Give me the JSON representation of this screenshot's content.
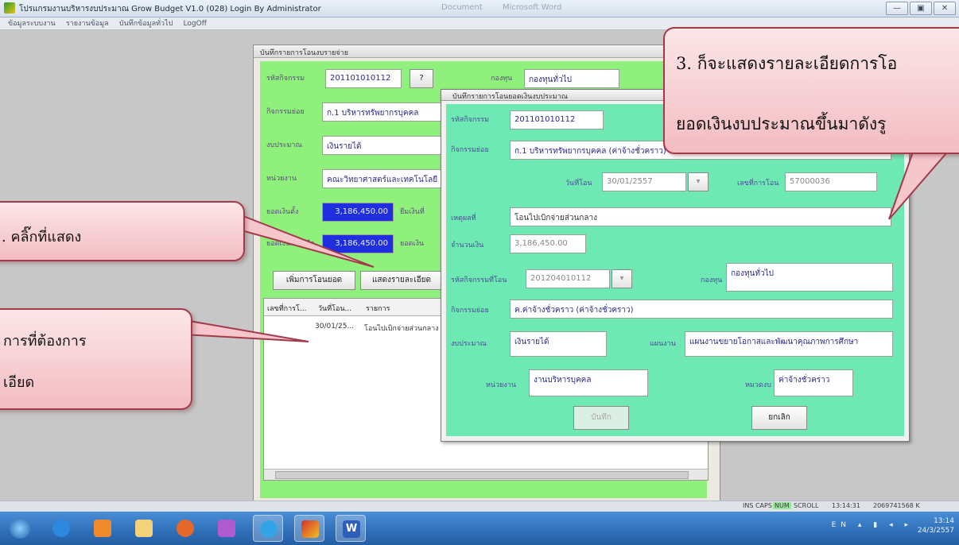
{
  "window": {
    "title": "โปรแกรมงานบริหารงบประมาณ Grow Budget V1.0 (028) Login By Administrator",
    "doc_tabs": [
      "Document",
      "Microsoft Word"
    ],
    "buttons": [
      "—",
      "▣",
      "✕"
    ]
  },
  "menu": [
    "ข้อมูลระบบงาน",
    "รายงานข้อมูล",
    "บันทึกข้อมูลทั่วไป",
    "LogOff"
  ],
  "parent": {
    "title": "บันทึกรายการโอนงบรายจ่าย",
    "code_label": "รหัสกิจกรรม",
    "code_value": "201101010112",
    "help_button": "?",
    "fund_group_label": "กองทุน",
    "fund_group_value": "กองทุนทั่วไป",
    "activity_label": "กิจกรรมย่อย",
    "activity_value": "ก.1 บริหารทรัพยากรบุคคล",
    "budget_type_label": "งบประมาณ",
    "budget_type_value": "เงินรายได้",
    "unit_label": "หน่วยงาน",
    "unit_value": "คณะวิทยาศาสตร์และเทคโนโลยี",
    "amount1_label": "ยอดเงินตั้ง",
    "amount1_value": "3,186,450.00",
    "amount1_suffix": "ยืมเงินที่",
    "amount2_label": "ยอดเงินคงเหลือ",
    "amount2_value": "3,186,450.00",
    "amount2_suffix": "ยอดเงิน",
    "add_button": "เพิ่มการโอนยอด",
    "detail_button": "แสดงรายละเอียด",
    "grid": {
      "headers": [
        "เลขที่การโ...",
        "วันที่โอน...",
        "รายการ"
      ],
      "rows": [
        [
          "",
          "30/01/25...",
          "โอนไปเบิกจ่ายส่วนกลาง"
        ]
      ]
    }
  },
  "child": {
    "title": "บันทึกรายการโอนยอดเงินงบประมาณ",
    "code_label": "รหัสกิจกรรม",
    "code_value": "201101010112",
    "activity_label": "กิจกรรมย่อย",
    "activity_value": "ก.1 บริหารทรัพยากรบุคคล (ค่าจ้างชั่วคราว)",
    "date_label": "วันที่โอน",
    "date_value": "30/01/2557",
    "transfer_no_label": "เลขที่การโอน",
    "transfer_no_value": "57000036",
    "reason_label": "เหตุผลที่",
    "reason_value": "โอนไปเบิกจ่ายส่วนกลาง",
    "amount_label": "จำนวนเงิน",
    "amount_value": "3,186,450.00",
    "dest_code_label": "รหัสกิจกรรมที่โอน",
    "dest_code_value": "201204010112",
    "dest_fund_label": "กองทุน",
    "dest_fund_value": "กองทุนทั่วไป",
    "dest_activity_label": "กิจกรรมย่อย",
    "dest_activity_value": "ค.ค่าจ้างชั่วคราว (ค่าจ้างชั่วคราว)",
    "dest_budget_label": "งบประมาณ",
    "dest_budget_value": "เงินรายได้",
    "dest_plan_label": "แผนงาน",
    "dest_plan_value": "แผนงานขยายโอกาสและพัฒนาคุณภาพการศึกษา",
    "dest_unit_label": "หน่วยงาน",
    "dest_unit_value": "งานบริหารบุคคล",
    "dest_category_label": "หมวดงบ",
    "dest_category_value": "ค่าจ้างชั่วคราว",
    "save_button": "บันทึก",
    "cancel_button": "ยกเลิก"
  },
  "callouts": {
    "c1": ". คลิ๊กที่แสดง",
    "c2_line1": "การที่ต้องการ",
    "c2_line2": "เอียด",
    "c3_line1": "3. ก็จะแสดงรายละเอียดการโอ",
    "c3_line2": "ยอดเงินงบประมาณขึ้นมาดังรู"
  },
  "status": {
    "keys": "INS CAPS",
    "num": "NUM",
    "scroll": "SCROLL",
    "time": "13:14:31",
    "mem": "2069741568 K"
  },
  "taskbar": {
    "time": "13:14",
    "date": "24/3/2557",
    "lang": "EN"
  },
  "colors": {
    "form_green": "#8ff07c",
    "dialog_green": "#6fe9b4",
    "amount_blue": "#1f2fe0",
    "callout_pink": "#f3bcc2"
  }
}
